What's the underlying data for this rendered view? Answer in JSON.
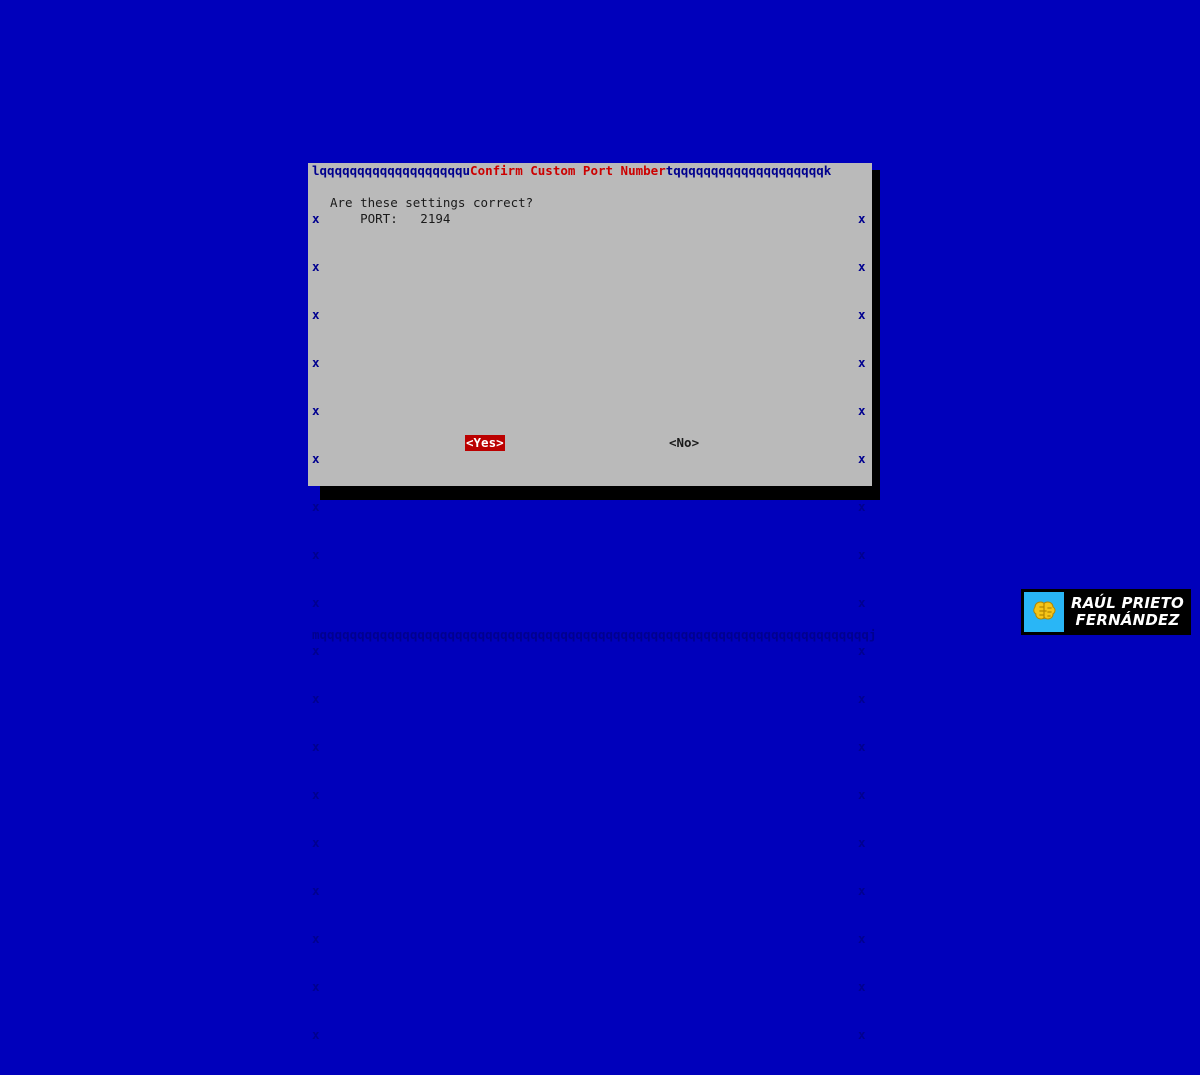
{
  "screen": {
    "background_color": "#0000bb",
    "type": "ncurses-dialog-terminal"
  },
  "dialog": {
    "title": "Confirm Custom Port Number",
    "title_color": "#cc0000",
    "background_color": "#bababa",
    "border_color": "#00008f",
    "top_border": "lqqqqqqqqqqqqqqqqqqqu",
    "top_border_right": "tqqqqqqqqqqqqqqqqqqqqk",
    "bottom_border": "mqqqqqqqqqqqqqqqqqqqqqqqqqqqqqqqqqqqqqqqqqqqqqqqqqqqqqqqqqqqqqqqqqqqqqqqqqj",
    "side_glyph": "x",
    "side_rows": 17,
    "body": {
      "question": "Are these settings correct?",
      "port_label": "PORT:",
      "port_value": "2194",
      "port_line": "    PORT:   2194"
    },
    "buttons": {
      "yes": {
        "label": "<Yes>",
        "selected": true,
        "background_color": "#bb0000",
        "text_color": "#ffffff"
      },
      "no": {
        "label": "<No>",
        "selected": false,
        "background_color": "transparent",
        "text_color": "#1a1a1a"
      }
    }
  },
  "watermark": {
    "line1": "RAÚL PRIETO",
    "line2": "FERNÁNDEZ",
    "logo_background": "#29b6f6",
    "logo_color": "#f5c518",
    "panel_background": "#000000",
    "text_color": "#ffffff",
    "icon": "brain-icon"
  }
}
